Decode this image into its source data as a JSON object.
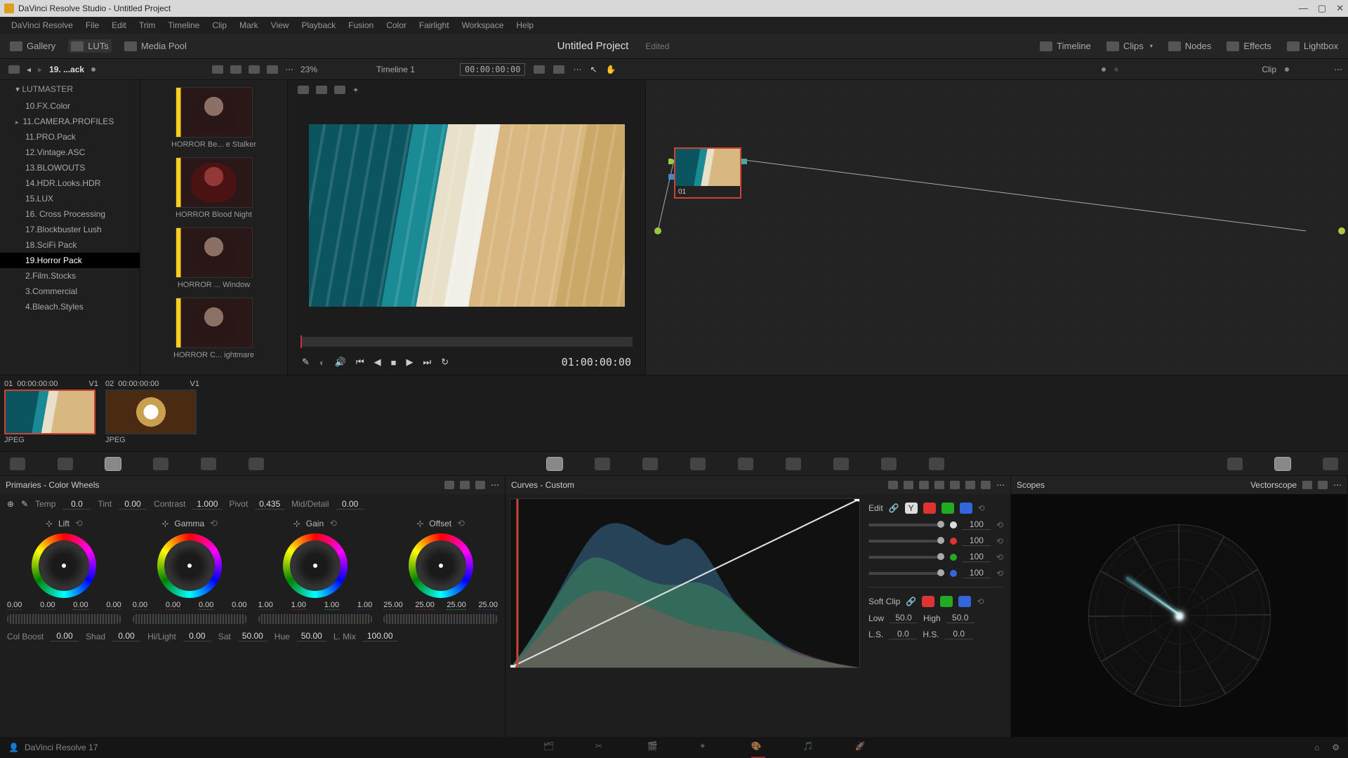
{
  "titlebar": {
    "text": "DaVinci Resolve Studio - Untitled Project"
  },
  "menubar": [
    "DaVinci Resolve",
    "File",
    "Edit",
    "Trim",
    "Timeline",
    "Clip",
    "Mark",
    "View",
    "Playback",
    "Fusion",
    "Color",
    "Fairlight",
    "Workspace",
    "Help"
  ],
  "toptoolbar": {
    "gallery": "Gallery",
    "luts": "LUTs",
    "mediapool": "Media Pool",
    "project_title": "Untitled Project",
    "edited": "Edited",
    "timeline": "Timeline",
    "clips": "Clips",
    "nodes": "Nodes",
    "effects": "Effects",
    "lightbox": "Lightbox"
  },
  "subtoolbar": {
    "breadcrumb": "19. ...ack",
    "zoom": "23%",
    "timeline_sel": "Timeline 1",
    "timecode": "00:00:00:00",
    "clip_mode": "Clip"
  },
  "sidebar": {
    "root": "LUTMASTER",
    "items": [
      {
        "label": "10.FX.Color"
      },
      {
        "label": "11.CAMERA.PROFILES",
        "hasChild": true
      },
      {
        "label": "11.PRO.Pack"
      },
      {
        "label": "12.Vintage.ASC"
      },
      {
        "label": "13.BLOWOUTS"
      },
      {
        "label": "14.HDR.Looks.HDR"
      },
      {
        "label": "15.LUX"
      },
      {
        "label": "16. Cross Processing"
      },
      {
        "label": "17.Blockbuster Lush"
      },
      {
        "label": "18.SciFi Pack"
      },
      {
        "label": "19.Horror Pack",
        "selected": true
      },
      {
        "label": "2.Film.Stocks"
      },
      {
        "label": "3.Commercial"
      },
      {
        "label": "4.Bleach.Styles"
      }
    ]
  },
  "lut_thumbs": [
    {
      "label": "HORROR Be... e Stalker"
    },
    {
      "label": "HORROR Blood Night"
    },
    {
      "label": "HORROR ... Window"
    },
    {
      "label": "HORROR C... ightmare"
    }
  ],
  "viewer": {
    "playhead_tc": "01:00:00:00"
  },
  "node": {
    "label": "01"
  },
  "clips": [
    {
      "index": "01",
      "tc": "00:00:00:00",
      "track": "V1",
      "format": "JPEG",
      "selected": true
    },
    {
      "index": "02",
      "tc": "00:00:00:00",
      "track": "V1",
      "format": "JPEG"
    }
  ],
  "primaries": {
    "title": "Primaries - Color Wheels",
    "temp": {
      "label": "Temp",
      "val": "0.0"
    },
    "tint": {
      "label": "Tint",
      "val": "0.00"
    },
    "contrast": {
      "label": "Contrast",
      "val": "1.000"
    },
    "pivot": {
      "label": "Pivot",
      "val": "0.435"
    },
    "middetail": {
      "label": "Mid/Detail",
      "val": "0.00"
    },
    "wheels": [
      {
        "name": "Lift",
        "v": [
          "0.00",
          "0.00",
          "0.00",
          "0.00"
        ]
      },
      {
        "name": "Gamma",
        "v": [
          "0.00",
          "0.00",
          "0.00",
          "0.00"
        ]
      },
      {
        "name": "Gain",
        "v": [
          "1.00",
          "1.00",
          "1.00",
          "1.00"
        ]
      },
      {
        "name": "Offset",
        "v": [
          "25.00",
          "25.00",
          "25.00",
          "25.00"
        ]
      }
    ],
    "row3": {
      "colboost": {
        "label": "Col Boost",
        "val": "0.00"
      },
      "shad": {
        "label": "Shad",
        "val": "0.00"
      },
      "hilight": {
        "label": "Hi/Light",
        "val": "0.00"
      },
      "sat": {
        "label": "Sat",
        "val": "50.00"
      },
      "hue": {
        "label": "Hue",
        "val": "50.00"
      },
      "lmix": {
        "label": "L. Mix",
        "val": "100.00"
      }
    }
  },
  "curves": {
    "title": "Curves - Custom",
    "edit_label": "Edit",
    "channels": [
      {
        "color": "white",
        "val": "100"
      },
      {
        "color": "red",
        "val": "100"
      },
      {
        "color": "green",
        "val": "100"
      },
      {
        "color": "blue",
        "val": "100"
      }
    ],
    "softclip": {
      "label": "Soft Clip",
      "low": {
        "label": "Low",
        "val": "50.0"
      },
      "high": {
        "label": "High",
        "val": "50.0"
      },
      "ls": {
        "label": "L.S.",
        "val": "0.0"
      },
      "hs": {
        "label": "H.S.",
        "val": "0.0"
      }
    }
  },
  "scopes": {
    "title": "Scopes",
    "mode": "Vectorscope"
  },
  "bottombar": {
    "version": "DaVinci Resolve 17"
  }
}
